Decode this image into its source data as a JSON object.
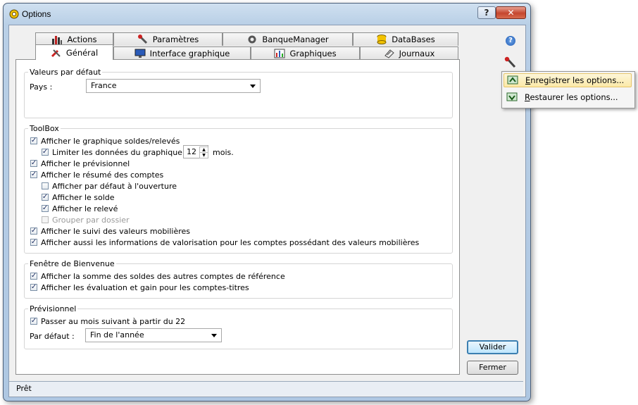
{
  "window": {
    "title": "Options",
    "buttons": {
      "help": "?",
      "close": "✕"
    }
  },
  "tabs": {
    "row_back": [
      {
        "label": "Actions",
        "icon": "bar-chart-icon"
      },
      {
        "label": "Paramètres",
        "icon": "wrench-icon"
      },
      {
        "label": "BanqueManager",
        "icon": "gear-icon"
      },
      {
        "label": "DataBases",
        "icon": "database-icon"
      }
    ],
    "row_front": [
      {
        "label": "Général",
        "icon": "tools-icon",
        "active": true
      },
      {
        "label": "Interface graphique",
        "icon": "monitor-icon"
      },
      {
        "label": "Graphiques",
        "icon": "chart-icon"
      },
      {
        "label": "Journaux",
        "icon": "journal-icon"
      }
    ]
  },
  "defaults_group": {
    "legend": "Valeurs par défaut",
    "country_label": "Pays :",
    "country_value": "France"
  },
  "toolbox_group": {
    "legend": "ToolBox",
    "items": [
      {
        "label": "Afficher le graphique soldes/relevés",
        "checked": true,
        "enabled": true
      },
      {
        "label_before": "Limiter les données du graphique à",
        "spin_value": "12",
        "label_after": "mois.",
        "checked": true,
        "enabled": true
      },
      {
        "label": "Afficher le prévisionnel",
        "checked": true,
        "enabled": true
      },
      {
        "label": "Afficher le résumé des comptes",
        "checked": true,
        "enabled": true
      },
      {
        "label": "Afficher par défaut à l'ouverture",
        "checked": false,
        "enabled": true
      },
      {
        "label": "Afficher le solde",
        "checked": true,
        "enabled": true
      },
      {
        "label": "Afficher le relevé",
        "checked": true,
        "enabled": true
      },
      {
        "label": "Grouper par dossier",
        "checked": false,
        "enabled": false
      },
      {
        "label": "Afficher le suivi des valeurs mobilières",
        "checked": true,
        "enabled": true
      },
      {
        "label": "Afficher aussi les informations de valorisation pour les comptes possédant des valeurs mobilières",
        "checked": true,
        "enabled": true
      }
    ]
  },
  "welcome_group": {
    "legend": "Fenêtre de Bienvenue",
    "items": [
      {
        "label": "Afficher la somme des soldes des autres comptes de référence",
        "checked": true
      },
      {
        "label": "Afficher les évaluation et gain pour les comptes-titres",
        "checked": true
      }
    ]
  },
  "forecast_group": {
    "legend": "Prévisionnel",
    "next_month": {
      "label": "Passer au mois suivant à partir du 22",
      "checked": true
    },
    "default_label": "Par défaut :",
    "default_value": "Fin de l'année"
  },
  "buttons": {
    "validate": "Valider",
    "close": "Fermer"
  },
  "side_icons": {
    "help": "help-icon",
    "tools": "wrench-icon"
  },
  "context_menu": {
    "items": [
      {
        "first": "E",
        "rest": "nregistrer les options...",
        "highlighted": true
      },
      {
        "first": "R",
        "rest": "estaurer les options...",
        "highlighted": false
      }
    ]
  },
  "status": {
    "text": "Prêt"
  },
  "colors": {
    "accent": "#3c7fb1",
    "check": "#1d2f63"
  }
}
